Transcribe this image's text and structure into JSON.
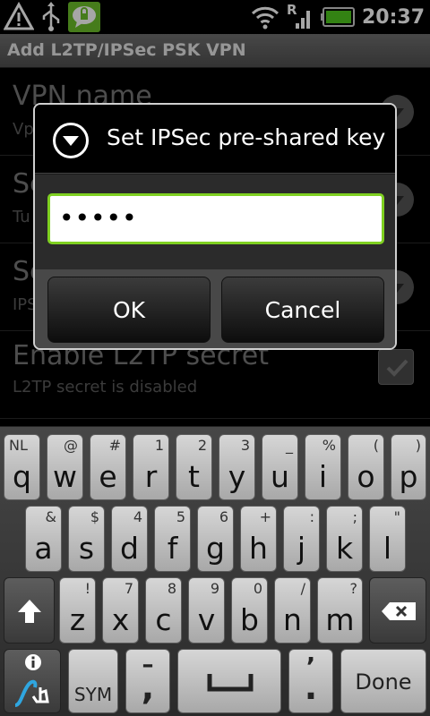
{
  "status_bar": {
    "time": "20:37",
    "left_icons": [
      "warning-icon",
      "usb-icon",
      "chat-lock-icon"
    ],
    "right_icons": [
      "wifi-icon",
      "signal-roaming-icon",
      "battery-icon"
    ],
    "roaming_letter": "R"
  },
  "title_bar": {
    "title": "Add L2TP/IPSec PSK VPN"
  },
  "settings": {
    "rows": [
      {
        "title": "VPN name",
        "subtitle": "Vp"
      },
      {
        "title": "Se",
        "subtitle": "Tu"
      },
      {
        "title": "Se",
        "subtitle": "IPS"
      },
      {
        "title": "Enable L2TP secret",
        "subtitle": "L2TP secret is disabled"
      }
    ]
  },
  "dialog": {
    "title": "Set IPSec pre-shared key",
    "password_value": "•••••",
    "ok_label": "OK",
    "cancel_label": "Cancel"
  },
  "keyboard": {
    "row1": [
      {
        "main": "q",
        "hint": "NL"
      },
      {
        "main": "w",
        "hint": "@"
      },
      {
        "main": "e",
        "hint": "#"
      },
      {
        "main": "r",
        "hint": "1"
      },
      {
        "main": "t",
        "hint": "2"
      },
      {
        "main": "y",
        "hint": "3"
      },
      {
        "main": "u",
        "hint": "_"
      },
      {
        "main": "i",
        "hint": "%"
      },
      {
        "main": "o",
        "hint": "("
      },
      {
        "main": "p",
        "hint": ")"
      }
    ],
    "row2": [
      {
        "main": "a",
        "hint": "&"
      },
      {
        "main": "s",
        "hint": "$"
      },
      {
        "main": "d",
        "hint": "4"
      },
      {
        "main": "f",
        "hint": "5"
      },
      {
        "main": "g",
        "hint": "6"
      },
      {
        "main": "h",
        "hint": "+"
      },
      {
        "main": "j",
        "hint": ":"
      },
      {
        "main": "k",
        "hint": ";"
      },
      {
        "main": "l",
        "hint": "\""
      }
    ],
    "row3": [
      {
        "main": "z",
        "hint": "!"
      },
      {
        "main": "x",
        "hint": "7"
      },
      {
        "main": "c",
        "hint": "8"
      },
      {
        "main": "v",
        "hint": "9"
      },
      {
        "main": "b",
        "hint": "0"
      },
      {
        "main": "n",
        "hint": "/"
      },
      {
        "main": "m",
        "hint": "?"
      }
    ],
    "sym_label": "SYM",
    "comma_main": ",",
    "comma_hint": "–",
    "period_main": ".",
    "period_hint": "’",
    "done_label": "Done"
  }
}
